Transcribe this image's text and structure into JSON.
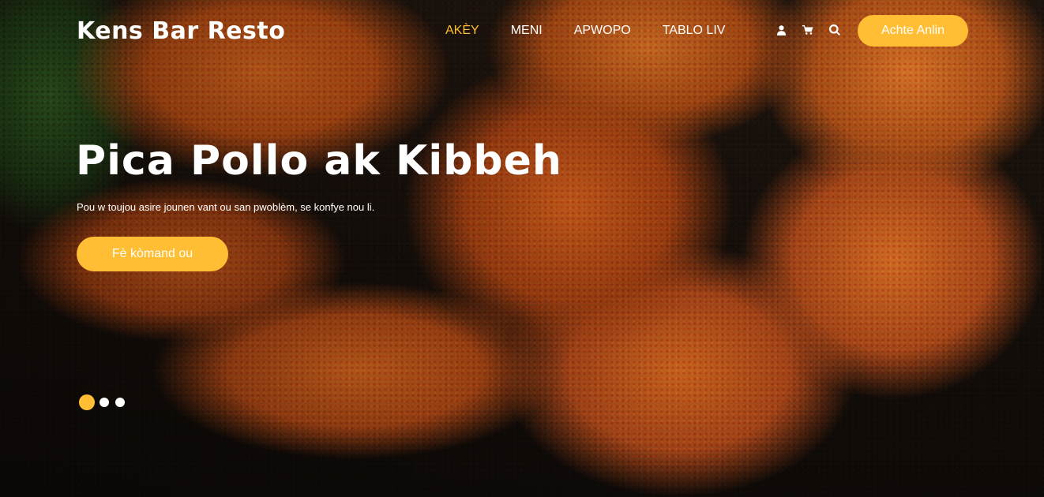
{
  "header": {
    "brand": "Kens Bar Resto",
    "nav": [
      {
        "label": "AKÈY",
        "active": true
      },
      {
        "label": "MENI",
        "active": false
      },
      {
        "label": "APWOPO",
        "active": false
      },
      {
        "label": "TABLO LIV",
        "active": false
      }
    ],
    "icons": [
      "user-icon",
      "cart-icon",
      "search-icon"
    ],
    "order_button": "Achte Anlin"
  },
  "hero": {
    "title": "Pica Pollo ak Kibbeh",
    "subtitle": "Pou w toujou asire jounen vant ou san pwoblèm, se konfye nou li.",
    "cta": "Fè kòmand ou",
    "slides": {
      "count": 3,
      "active_index": 0
    }
  },
  "colors": {
    "accent": "#ffbe33",
    "text": "#ffffff"
  }
}
